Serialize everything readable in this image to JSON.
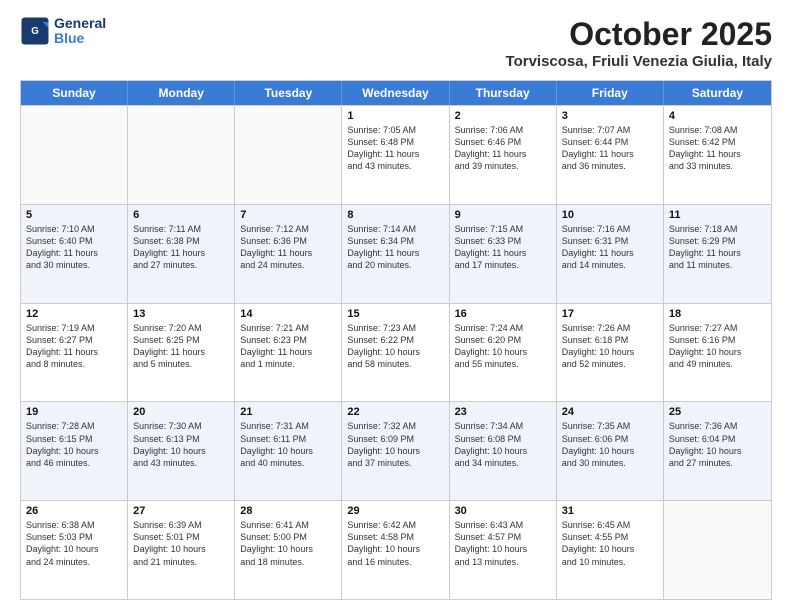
{
  "logo": {
    "line1": "General",
    "line2": "Blue"
  },
  "title": "October 2025",
  "location": "Torviscosa, Friuli Venezia Giulia, Italy",
  "days": [
    "Sunday",
    "Monday",
    "Tuesday",
    "Wednesday",
    "Thursday",
    "Friday",
    "Saturday"
  ],
  "rows": [
    [
      {
        "num": "",
        "info": ""
      },
      {
        "num": "",
        "info": ""
      },
      {
        "num": "",
        "info": ""
      },
      {
        "num": "1",
        "info": "Sunrise: 7:05 AM\nSunset: 6:48 PM\nDaylight: 11 hours\nand 43 minutes."
      },
      {
        "num": "2",
        "info": "Sunrise: 7:06 AM\nSunset: 6:46 PM\nDaylight: 11 hours\nand 39 minutes."
      },
      {
        "num": "3",
        "info": "Sunrise: 7:07 AM\nSunset: 6:44 PM\nDaylight: 11 hours\nand 36 minutes."
      },
      {
        "num": "4",
        "info": "Sunrise: 7:08 AM\nSunset: 6:42 PM\nDaylight: 11 hours\nand 33 minutes."
      }
    ],
    [
      {
        "num": "5",
        "info": "Sunrise: 7:10 AM\nSunset: 6:40 PM\nDaylight: 11 hours\nand 30 minutes."
      },
      {
        "num": "6",
        "info": "Sunrise: 7:11 AM\nSunset: 6:38 PM\nDaylight: 11 hours\nand 27 minutes."
      },
      {
        "num": "7",
        "info": "Sunrise: 7:12 AM\nSunset: 6:36 PM\nDaylight: 11 hours\nand 24 minutes."
      },
      {
        "num": "8",
        "info": "Sunrise: 7:14 AM\nSunset: 6:34 PM\nDaylight: 11 hours\nand 20 minutes."
      },
      {
        "num": "9",
        "info": "Sunrise: 7:15 AM\nSunset: 6:33 PM\nDaylight: 11 hours\nand 17 minutes."
      },
      {
        "num": "10",
        "info": "Sunrise: 7:16 AM\nSunset: 6:31 PM\nDaylight: 11 hours\nand 14 minutes."
      },
      {
        "num": "11",
        "info": "Sunrise: 7:18 AM\nSunset: 6:29 PM\nDaylight: 11 hours\nand 11 minutes."
      }
    ],
    [
      {
        "num": "12",
        "info": "Sunrise: 7:19 AM\nSunset: 6:27 PM\nDaylight: 11 hours\nand 8 minutes."
      },
      {
        "num": "13",
        "info": "Sunrise: 7:20 AM\nSunset: 6:25 PM\nDaylight: 11 hours\nand 5 minutes."
      },
      {
        "num": "14",
        "info": "Sunrise: 7:21 AM\nSunset: 6:23 PM\nDaylight: 11 hours\nand 1 minute."
      },
      {
        "num": "15",
        "info": "Sunrise: 7:23 AM\nSunset: 6:22 PM\nDaylight: 10 hours\nand 58 minutes."
      },
      {
        "num": "16",
        "info": "Sunrise: 7:24 AM\nSunset: 6:20 PM\nDaylight: 10 hours\nand 55 minutes."
      },
      {
        "num": "17",
        "info": "Sunrise: 7:26 AM\nSunset: 6:18 PM\nDaylight: 10 hours\nand 52 minutes."
      },
      {
        "num": "18",
        "info": "Sunrise: 7:27 AM\nSunset: 6:16 PM\nDaylight: 10 hours\nand 49 minutes."
      }
    ],
    [
      {
        "num": "19",
        "info": "Sunrise: 7:28 AM\nSunset: 6:15 PM\nDaylight: 10 hours\nand 46 minutes."
      },
      {
        "num": "20",
        "info": "Sunrise: 7:30 AM\nSunset: 6:13 PM\nDaylight: 10 hours\nand 43 minutes."
      },
      {
        "num": "21",
        "info": "Sunrise: 7:31 AM\nSunset: 6:11 PM\nDaylight: 10 hours\nand 40 minutes."
      },
      {
        "num": "22",
        "info": "Sunrise: 7:32 AM\nSunset: 6:09 PM\nDaylight: 10 hours\nand 37 minutes."
      },
      {
        "num": "23",
        "info": "Sunrise: 7:34 AM\nSunset: 6:08 PM\nDaylight: 10 hours\nand 34 minutes."
      },
      {
        "num": "24",
        "info": "Sunrise: 7:35 AM\nSunset: 6:06 PM\nDaylight: 10 hours\nand 30 minutes."
      },
      {
        "num": "25",
        "info": "Sunrise: 7:36 AM\nSunset: 6:04 PM\nDaylight: 10 hours\nand 27 minutes."
      }
    ],
    [
      {
        "num": "26",
        "info": "Sunrise: 6:38 AM\nSunset: 5:03 PM\nDaylight: 10 hours\nand 24 minutes."
      },
      {
        "num": "27",
        "info": "Sunrise: 6:39 AM\nSunset: 5:01 PM\nDaylight: 10 hours\nand 21 minutes."
      },
      {
        "num": "28",
        "info": "Sunrise: 6:41 AM\nSunset: 5:00 PM\nDaylight: 10 hours\nand 18 minutes."
      },
      {
        "num": "29",
        "info": "Sunrise: 6:42 AM\nSunset: 4:58 PM\nDaylight: 10 hours\nand 16 minutes."
      },
      {
        "num": "30",
        "info": "Sunrise: 6:43 AM\nSunset: 4:57 PM\nDaylight: 10 hours\nand 13 minutes."
      },
      {
        "num": "31",
        "info": "Sunrise: 6:45 AM\nSunset: 4:55 PM\nDaylight: 10 hours\nand 10 minutes."
      },
      {
        "num": "",
        "info": ""
      }
    ]
  ]
}
